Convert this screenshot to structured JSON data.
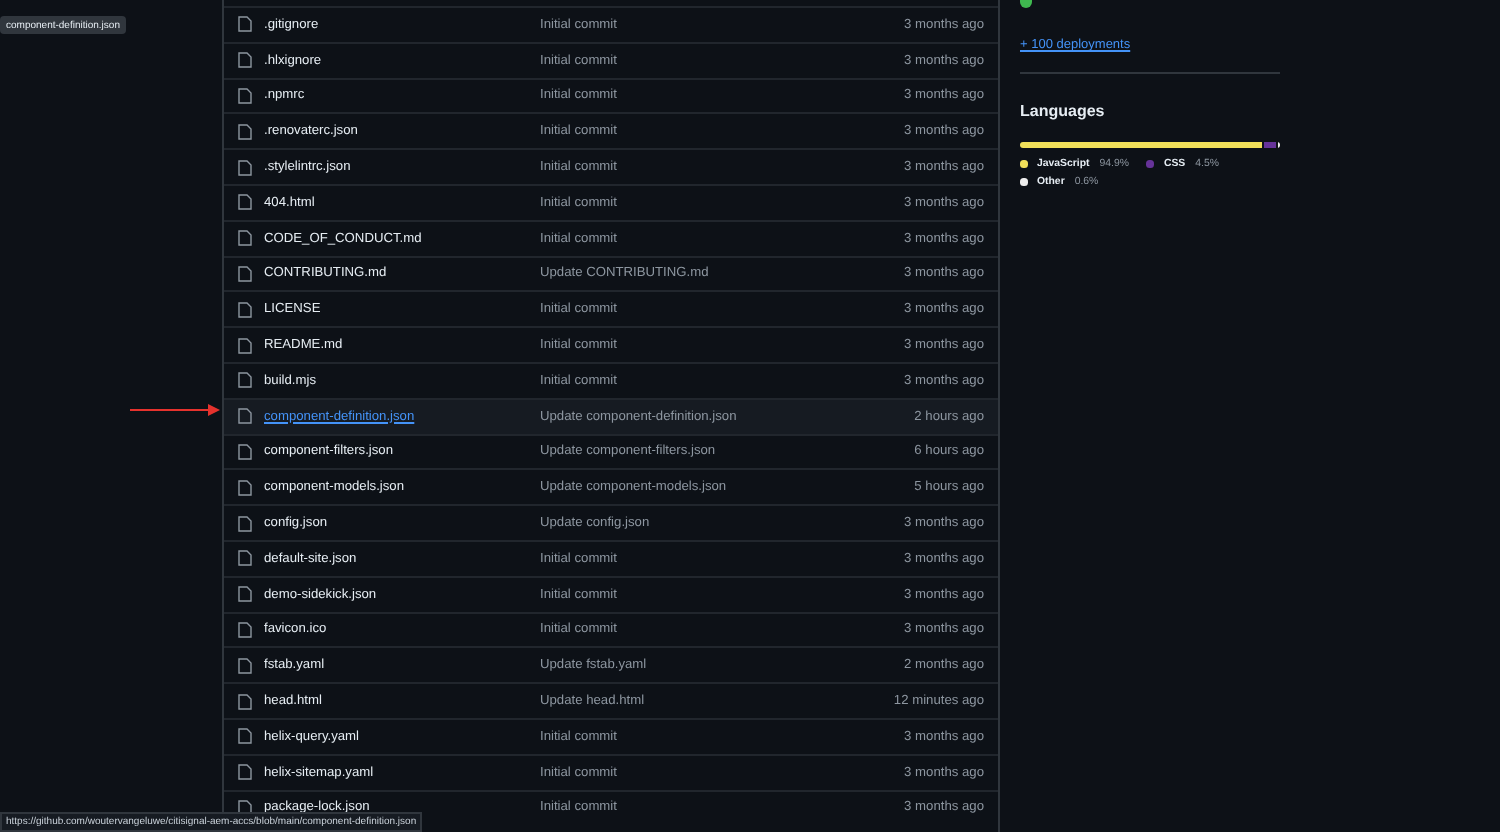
{
  "tooltip": "component-definition.json",
  "files": [
    {
      "name": ".gitignore",
      "message": "Initial commit",
      "time": "3 months ago",
      "hovered": false
    },
    {
      "name": ".hlxignore",
      "message": "Initial commit",
      "time": "3 months ago",
      "hovered": false
    },
    {
      "name": ".npmrc",
      "message": "Initial commit",
      "time": "3 months ago",
      "hovered": false
    },
    {
      "name": ".renovaterc.json",
      "message": "Initial commit",
      "time": "3 months ago",
      "hovered": false
    },
    {
      "name": ".stylelintrc.json",
      "message": "Initial commit",
      "time": "3 months ago",
      "hovered": false
    },
    {
      "name": "404.html",
      "message": "Initial commit",
      "time": "3 months ago",
      "hovered": false
    },
    {
      "name": "CODE_OF_CONDUCT.md",
      "message": "Initial commit",
      "time": "3 months ago",
      "hovered": false
    },
    {
      "name": "CONTRIBUTING.md",
      "message": "Update CONTRIBUTING.md",
      "time": "3 months ago",
      "hovered": false
    },
    {
      "name": "LICENSE",
      "message": "Initial commit",
      "time": "3 months ago",
      "hovered": false
    },
    {
      "name": "README.md",
      "message": "Initial commit",
      "time": "3 months ago",
      "hovered": false
    },
    {
      "name": "build.mjs",
      "message": "Initial commit",
      "time": "3 months ago",
      "hovered": false
    },
    {
      "name": "component-definition.json",
      "message": "Update component-definition.json",
      "time": "2 hours ago",
      "hovered": true
    },
    {
      "name": "component-filters.json",
      "message": "Update component-filters.json",
      "time": "6 hours ago",
      "hovered": false
    },
    {
      "name": "component-models.json",
      "message": "Update component-models.json",
      "time": "5 hours ago",
      "hovered": false
    },
    {
      "name": "config.json",
      "message": "Update config.json",
      "time": "3 months ago",
      "hovered": false
    },
    {
      "name": "default-site.json",
      "message": "Initial commit",
      "time": "3 months ago",
      "hovered": false
    },
    {
      "name": "demo-sidekick.json",
      "message": "Initial commit",
      "time": "3 months ago",
      "hovered": false
    },
    {
      "name": "favicon.ico",
      "message": "Initial commit",
      "time": "3 months ago",
      "hovered": false
    },
    {
      "name": "fstab.yaml",
      "message": "Update fstab.yaml",
      "time": "2 months ago",
      "hovered": false
    },
    {
      "name": "head.html",
      "message": "Update head.html",
      "time": "12 minutes ago",
      "hovered": false
    },
    {
      "name": "helix-query.yaml",
      "message": "Initial commit",
      "time": "3 months ago",
      "hovered": false
    },
    {
      "name": "helix-sitemap.yaml",
      "message": "Initial commit",
      "time": "3 months ago",
      "hovered": false
    },
    {
      "name": "package-lock.json",
      "message": "Initial commit",
      "time": "3 months ago",
      "hovered": false
    }
  ],
  "sidebar": {
    "deployments_link": "+ 100 deployments",
    "languages_title": "Languages",
    "languages": [
      {
        "name": "JavaScript",
        "percent": "94.9%",
        "color": "#f1e05a"
      },
      {
        "name": "CSS",
        "percent": "4.5%",
        "color": "#663399"
      },
      {
        "name": "Other",
        "percent": "0.6%",
        "color": "#ededed"
      }
    ]
  },
  "status_bar": "https://github.com/woutervangeluwe/citisignal-aem-accs/blob/main/component-definition.json"
}
